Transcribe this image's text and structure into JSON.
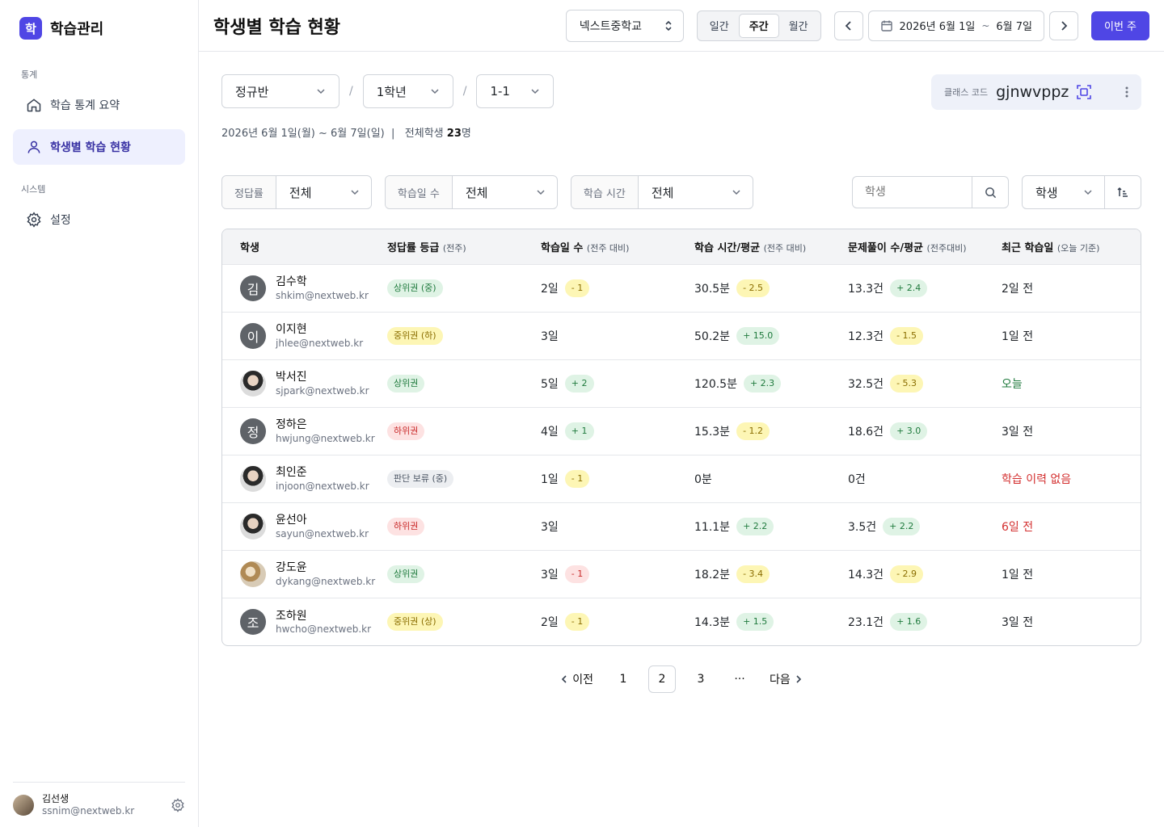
{
  "brand": {
    "logo_letter": "학",
    "name": "학습관리"
  },
  "sidebar": {
    "section_stats": "통계",
    "section_system": "시스템",
    "items": [
      {
        "label": "학습 통계 요약",
        "icon": "home-icon"
      },
      {
        "label": "학생별 학습 현황",
        "icon": "user-icon"
      },
      {
        "label": "설정",
        "icon": "gear-icon"
      }
    ],
    "user": {
      "name": "김선생",
      "email": "ssnim@nextweb.kr"
    }
  },
  "header": {
    "title": "학생별 학습 현황",
    "school": "넥스트중학교",
    "periods": [
      "일간",
      "주간",
      "월간"
    ],
    "active_period": "주간",
    "date_start": "2026년 6월 1일",
    "date_sep": "~",
    "date_end": "6월 7일",
    "this_week": "이번 주"
  },
  "filters": {
    "class_type": "정규반",
    "grade": "1학년",
    "class": "1-1",
    "slash": "/"
  },
  "class_code": {
    "label": "클래스 코드",
    "value": "gjnwvppz"
  },
  "summary": {
    "period": "2026년 6월 1일(월) ~ 6월 7일(일)",
    "divider": "|",
    "total_label": "전체학생",
    "total_count": "23",
    "total_unit": "명"
  },
  "filters2": {
    "accuracy_label": "정답률",
    "accuracy_value": "전체",
    "days_label": "학습일 수",
    "days_value": "전체",
    "time_label": "학습 시간",
    "time_value": "전체",
    "search_placeholder": "학생",
    "sort_value": "학생"
  },
  "table": {
    "headers": [
      {
        "main": "학생",
        "sub": ""
      },
      {
        "main": "정답률 등급",
        "sub": "(전주)"
      },
      {
        "main": "학습일 수",
        "sub": "(전주 대비)"
      },
      {
        "main": "학습 시간/평균",
        "sub": "(전주 대비)"
      },
      {
        "main": "문제풀이 수/평균",
        "sub": "(전주대비)"
      },
      {
        "main": "최근 학습일",
        "sub": "(오늘 기준)"
      }
    ],
    "rows": [
      {
        "initial": "김",
        "photo": "",
        "name": "김수학",
        "email": "shkim@nextweb.kr",
        "grade": "상위권 (중)",
        "grade_color": "green",
        "days": "2일",
        "days_delta": "- 1",
        "days_color": "yellow",
        "time": "30.5분",
        "time_delta": "- 2.5",
        "time_color": "yellow",
        "problems": "13.3건",
        "prob_delta": "+ 2.4",
        "prob_color": "green",
        "recent": "2일 전",
        "recent_color": ""
      },
      {
        "initial": "이",
        "photo": "",
        "name": "이지현",
        "email": "jhlee@nextweb.kr",
        "grade": "중위권 (하)",
        "grade_color": "yellow",
        "days": "3일",
        "days_delta": "",
        "days_color": "",
        "time": "50.2분",
        "time_delta": "+ 15.0",
        "time_color": "green",
        "problems": "12.3건",
        "prob_delta": "- 1.5",
        "prob_color": "yellow",
        "recent": "1일 전",
        "recent_color": ""
      },
      {
        "initial": "",
        "photo": "photo",
        "name": "박서진",
        "email": "sjpark@nextweb.kr",
        "grade": "상위권",
        "grade_color": "green",
        "days": "5일",
        "days_delta": "+ 2",
        "days_color": "green",
        "time": "120.5분",
        "time_delta": "+ 2.3",
        "time_color": "green",
        "problems": "32.5건",
        "prob_delta": "- 5.3",
        "prob_color": "yellow",
        "recent": "오늘",
        "recent_color": "green"
      },
      {
        "initial": "정",
        "photo": "",
        "name": "정하은",
        "email": "hwjung@nextweb.kr",
        "grade": "하위권",
        "grade_color": "red",
        "days": "4일",
        "days_delta": "+ 1",
        "days_color": "green",
        "time": "15.3분",
        "time_delta": "- 1.2",
        "time_color": "yellow",
        "problems": "18.6건",
        "prob_delta": "+ 3.0",
        "prob_color": "green",
        "recent": "3일 전",
        "recent_color": ""
      },
      {
        "initial": "",
        "photo": "photo",
        "name": "최인준",
        "email": "injoon@nextweb.kr",
        "grade": "판단 보류 (중)",
        "grade_color": "gray",
        "days": "1일",
        "days_delta": "- 1",
        "days_color": "yellow",
        "time": "0분",
        "time_delta": "",
        "time_color": "",
        "problems": "0건",
        "prob_delta": "",
        "prob_color": "",
        "recent": "학습 이력 없음",
        "recent_color": "red"
      },
      {
        "initial": "",
        "photo": "photo",
        "name": "윤선아",
        "email": "sayun@nextweb.kr",
        "grade": "하위권",
        "grade_color": "red",
        "days": "3일",
        "days_delta": "",
        "days_color": "",
        "time": "11.1분",
        "time_delta": "+ 2.2",
        "time_color": "green",
        "problems": "3.5건",
        "prob_delta": "+ 2.2",
        "prob_color": "green",
        "recent": "6일 전",
        "recent_color": "red"
      },
      {
        "initial": "",
        "photo": "photo2",
        "name": "강도윤",
        "email": "dykang@nextweb.kr",
        "grade": "상위권",
        "grade_color": "green",
        "days": "3일",
        "days_delta": "- 1",
        "days_color": "red",
        "time": "18.2분",
        "time_delta": "- 3.4",
        "time_color": "yellow",
        "problems": "14.3건",
        "prob_delta": "- 2.9",
        "prob_color": "yellow",
        "recent": "1일 전",
        "recent_color": ""
      },
      {
        "initial": "조",
        "photo": "",
        "name": "조하원",
        "email": "hwcho@nextweb.kr",
        "grade": "중위권 (상)",
        "grade_color": "yellow",
        "days": "2일",
        "days_delta": "- 1",
        "days_color": "yellow",
        "time": "14.3분",
        "time_delta": "+ 1.5",
        "time_color": "green",
        "problems": "23.1건",
        "prob_delta": "+ 1.6",
        "prob_color": "green",
        "recent": "3일 전",
        "recent_color": ""
      }
    ]
  },
  "pagination": {
    "prev": "이전",
    "next": "다음",
    "pages": [
      "1",
      "2",
      "3"
    ],
    "active": "2",
    "ellipsis": "···"
  }
}
